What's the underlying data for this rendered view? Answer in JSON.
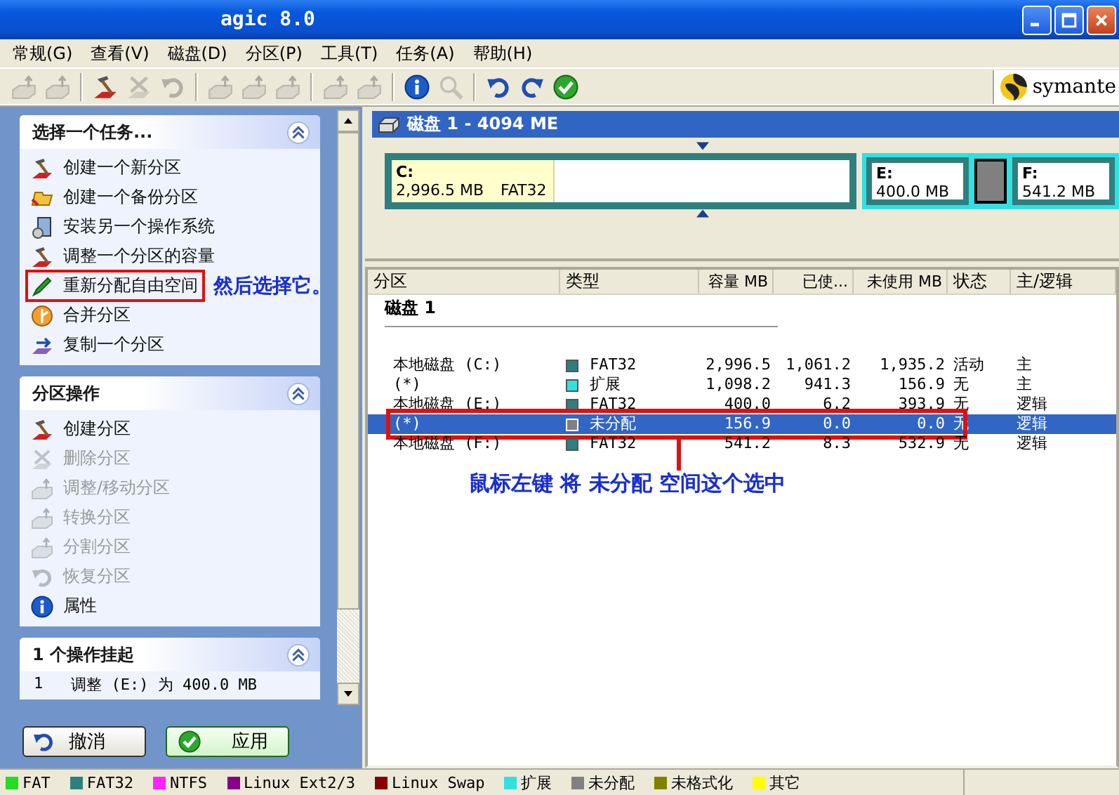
{
  "window": {
    "title": "agic 8.0"
  },
  "menu": [
    "常规(G)",
    "查看(V)",
    "磁盘(D)",
    "分区(P)",
    "工具(T)",
    "任务(A)",
    "帮助(H)"
  ],
  "toolbar": [
    {
      "items": [
        {
          "kind": "disk",
          "disabled": true
        },
        {
          "kind": "disk",
          "disabled": true
        }
      ]
    },
    {
      "items": [
        {
          "kind": "hammer",
          "disabled": false
        },
        {
          "kind": "cross",
          "disabled": true
        },
        {
          "kind": "undo",
          "disabled": true
        }
      ]
    },
    {
      "items": [
        {
          "kind": "disk",
          "disabled": true
        },
        {
          "kind": "disk",
          "disabled": true
        },
        {
          "kind": "disk",
          "disabled": true
        }
      ]
    },
    {
      "items": [
        {
          "kind": "disk",
          "disabled": true
        },
        {
          "kind": "disk",
          "disabled": true
        }
      ]
    },
    {
      "items": [
        {
          "kind": "info",
          "disabled": false
        },
        {
          "kind": "search",
          "disabled": true
        }
      ]
    },
    {
      "items": [
        {
          "kind": "undo",
          "disabled": false
        },
        {
          "kind": "redo",
          "disabled": false
        },
        {
          "kind": "check",
          "disabled": false
        }
      ]
    }
  ],
  "logo": {
    "text": "symante"
  },
  "task_panels": [
    {
      "title": "选择一个任务...",
      "expanded": true,
      "items": [
        {
          "label": "创建一个新分区",
          "kind": "hammer",
          "disabled": false,
          "highlighted": false
        },
        {
          "label": "创建一个备份分区",
          "kind": "folder",
          "disabled": false,
          "highlighted": false
        },
        {
          "label": "安装另一个操作系统",
          "kind": "install",
          "disabled": false,
          "highlighted": false
        },
        {
          "label": "调整一个分区的容量",
          "kind": "hammer",
          "disabled": false,
          "highlighted": false
        },
        {
          "label": "重新分配自由空间",
          "kind": "pen",
          "disabled": false,
          "highlighted": true,
          "note": "然后选择它。"
        },
        {
          "label": "合并分区",
          "kind": "merge",
          "disabled": false,
          "highlighted": false
        },
        {
          "label": "复制一个分区",
          "kind": "copy",
          "disabled": false,
          "highlighted": false
        }
      ]
    },
    {
      "title": "分区操作",
      "expanded": true,
      "items": [
        {
          "label": "创建分区",
          "kind": "hammer",
          "disabled": false,
          "highlighted": false
        },
        {
          "label": "删除分区",
          "kind": "cross",
          "disabled": true,
          "highlighted": false
        },
        {
          "label": "调整/移动分区",
          "kind": "disk",
          "disabled": true,
          "highlighted": false
        },
        {
          "label": "转换分区",
          "kind": "disk",
          "disabled": true,
          "highlighted": false
        },
        {
          "label": "分割分区",
          "kind": "disk",
          "disabled": true,
          "highlighted": false
        },
        {
          "label": "恢复分区",
          "kind": "undo",
          "disabled": true,
          "highlighted": false
        },
        {
          "label": "属性",
          "kind": "info",
          "disabled": false,
          "highlighted": false
        }
      ]
    }
  ],
  "pending": {
    "title": "1 个操作挂起",
    "expanded": true,
    "items": [
      {
        "number": "1",
        "text": "调整  (E:) 为 400.0 MB"
      }
    ]
  },
  "buttons": [
    {
      "label": "撤消",
      "kind": "undo"
    },
    {
      "label": "应用",
      "kind": "check"
    }
  ],
  "disk_map": {
    "title": "磁盘 1 - 4094 ME",
    "partitions": [
      {
        "kind": "primary",
        "letter": "C:",
        "size": "2,996.5 MB",
        "fs": "FAT32",
        "level": 0.354
      },
      {
        "kind": "extended",
        "children": [
          {
            "kind": "logical",
            "letter": "E:",
            "size": "400.0 MB"
          },
          {
            "kind": "unallocated"
          },
          {
            "kind": "logical",
            "letter": "F:",
            "size": "541.2 MB"
          }
        ]
      }
    ]
  },
  "partition_table": {
    "columns": [
      "分区",
      "类型",
      "容量 MB",
      "已使...",
      "未使用 MB",
      "状态",
      "主/逻辑"
    ],
    "group": "磁盘 1",
    "rows": [
      {
        "partition": "本地磁盘 (C:)",
        "color": "#2f7f7f",
        "type": "FAT32",
        "capacity": "2,996.5",
        "used": "1,061.2",
        "unused": "1,935.2",
        "status": "活动",
        "primary_logical": "主",
        "selected": false,
        "highlighted": false
      },
      {
        "partition": "(*)",
        "color": "#33e0e0",
        "type": "扩展",
        "capacity": "1,098.2",
        "used": "941.3",
        "unused": "156.9",
        "status": "无",
        "primary_logical": "主",
        "selected": false,
        "highlighted": false
      },
      {
        "partition": "本地磁盘 (E:)",
        "color": "#2f7f7f",
        "type": "FAT32",
        "capacity": "400.0",
        "used": "6.2",
        "unused": "393.9",
        "status": "无",
        "primary_logical": "逻辑",
        "selected": false,
        "highlighted": false
      },
      {
        "partition": "(*)",
        "color": "#808080",
        "type": "未分配",
        "capacity": "156.9",
        "used": "0.0",
        "unused": "0.0",
        "status": "无",
        "primary_logical": "逻辑",
        "selected": true,
        "highlighted": true
      },
      {
        "partition": "本地磁盘 (F:)",
        "color": "#2f7f7f",
        "type": "FAT32",
        "capacity": "541.2",
        "used": "8.3",
        "unused": "532.9",
        "status": "无",
        "primary_logical": "逻辑",
        "selected": false,
        "highlighted": false
      }
    ],
    "note": "鼠标左键 将 未分配 空间这个选中"
  },
  "legend": [
    {
      "label": "FAT",
      "color": "#22dd22"
    },
    {
      "label": "FAT32",
      "color": "#2f7f7f"
    },
    {
      "label": "NTFS",
      "color": "#ff22ff"
    },
    {
      "label": "Linux Ext2/3",
      "color": "#880088"
    },
    {
      "label": "Linux Swap",
      "color": "#880000"
    },
    {
      "label": "扩展",
      "color": "#33e0e0"
    },
    {
      "label": "未分配",
      "color": "#808080"
    },
    {
      "label": "未格式化",
      "color": "#808000"
    },
    {
      "label": "其它",
      "color": "#ffff00"
    }
  ]
}
